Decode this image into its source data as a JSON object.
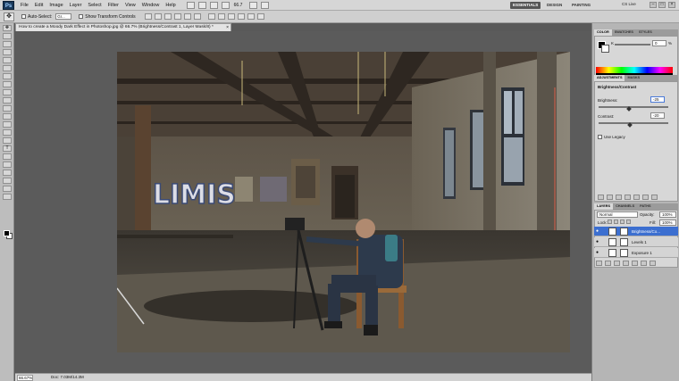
{
  "menu": {
    "logo": "Ps",
    "items": [
      "File",
      "Edit",
      "Image",
      "Layer",
      "Select",
      "Filter",
      "View",
      "Window",
      "Help"
    ],
    "zoom": "66.7",
    "workspaces": [
      "ESSENTIALS",
      "DESIGN",
      "PAINTING"
    ],
    "cs_live": "CS Live"
  },
  "options": {
    "auto_select_label": "Auto-Select:",
    "auto_select_value": "Gr...",
    "show_transform_label": "Show Transform Controls"
  },
  "document": {
    "tab_title": "How to create a Moody Dark Effect in Photoshop.jpg @ 66.7% (Brightness/Contrast 1, Layer Mask/8) *",
    "close": "×"
  },
  "status": {
    "zoom": "66.67%",
    "doc": "Doc: 7.03M/14.3M"
  },
  "color_panel": {
    "tabs": [
      "COLOR",
      "SWATCHES",
      "STYLES"
    ],
    "k_label": "K",
    "k_value": "0",
    "percent": "%"
  },
  "adjustments": {
    "tabs": [
      "ADJUSTMENTS",
      "MASKS"
    ],
    "title": "Brightness/Contrast",
    "brightness_label": "Brightness:",
    "brightness_value": "-25",
    "contrast_label": "Contrast:",
    "contrast_value": "-20",
    "legacy_label": "Use Legacy",
    "brightness_frac": 0.44,
    "contrast_frac": 0.45
  },
  "layers": {
    "tabs": [
      "LAYERS",
      "CHANNELS",
      "PATHS"
    ],
    "blend_mode": "Normal",
    "opacity_label": "Opacity:",
    "opacity_value": "100%",
    "lock_label": "Lock:",
    "fill_label": "Fill:",
    "fill_value": "100%",
    "rows": [
      {
        "name": "Brightness/Co...",
        "active": true
      },
      {
        "name": "Levels 1",
        "active": false
      },
      {
        "name": "Exposure 1",
        "active": false
      }
    ]
  }
}
